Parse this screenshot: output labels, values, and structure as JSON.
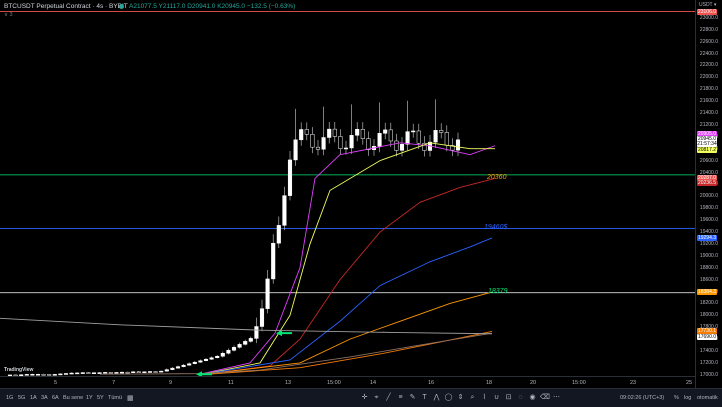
{
  "header": {
    "symbol": "BTCUSDT Perpetual Contract · 4s · BYBIT",
    "ohlc": "A21077.5 Y21117.0 D20941.0 K20945.0 −132.5 (−0.63%)",
    "sub": "∨ 3"
  },
  "chart_data": {
    "type": "candlestick",
    "y_axis_ticks": [
      "23000.0",
      "22800.0",
      "22600.0",
      "22400.0",
      "22200.0",
      "22000.0",
      "21800.0",
      "21600.0",
      "21400.0",
      "21200.0",
      "21000.0",
      "20800.0",
      "20600.0",
      "20400.0",
      "20200.0",
      "20000.0",
      "19800.0",
      "19600.0",
      "19400.0",
      "19200.0",
      "19000.0",
      "18800.0",
      "18600.0",
      "18400.0",
      "18200.0",
      "18000.0",
      "17800.0",
      "17600.0",
      "17400.0",
      "17200.0",
      "17000.0"
    ],
    "x_axis_ticks": [
      "5",
      "7",
      "9",
      "11",
      "13",
      "15:00",
      "14",
      "16",
      "18",
      "20",
      "15:00",
      "23",
      "25",
      "27"
    ],
    "ylim": [
      16980,
      23300
    ],
    "price_labels": [
      {
        "value": "23106.0",
        "color": "#ef5350"
      },
      {
        "value": "20905.0",
        "color": "#e040fb"
      },
      {
        "value": "20945.0",
        "color": "#ffffff"
      },
      {
        "value": "21:57:34",
        "color": "#ffffff"
      },
      {
        "value": "20817.2",
        "color": "#f2ff5c"
      },
      {
        "value": "20287.0",
        "color": "#ef5350"
      },
      {
        "value": "20236.5",
        "color": "#c62828"
      },
      {
        "value": "19294.3",
        "color": "#2962ff"
      },
      {
        "value": "18384.3",
        "color": "#ff9800"
      },
      {
        "value": "17730.1",
        "color": "#f57c00"
      },
      {
        "value": "17690.0",
        "color": "#ffffff"
      }
    ],
    "horizontal_lines": [
      {
        "value": "20360",
        "color": "#00e676"
      },
      {
        "value": "19460$",
        "color": "#2962ff"
      },
      {
        "value": "18379",
        "color": "#ffffff"
      }
    ]
  },
  "bottom": {
    "timeframes": [
      "1G",
      "5G",
      "1A",
      "3A",
      "6A",
      "Bu sene",
      "1Y",
      "5Y",
      "Tümü"
    ],
    "time": "09:02:26 (UTC+3)",
    "pct": "%",
    "log": "log",
    "auto": "otomatik"
  },
  "logo": "TradingView",
  "axis_unit": "USDT ▾"
}
